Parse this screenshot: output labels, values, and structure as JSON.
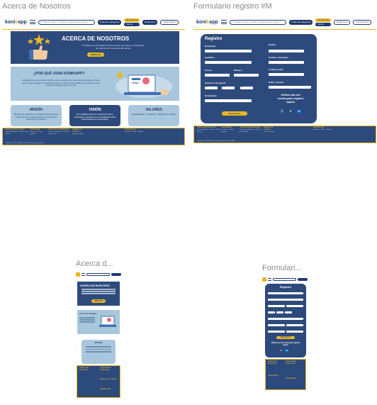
{
  "frames": {
    "acerca_desktop_label": "Acerca de Nosotros",
    "registro_desktop_label": "Formulario registro #M",
    "acerca_mobile_label": "Acerca d...",
    "registro_mobile_label": "Formulari..."
  },
  "header": {
    "logo_a": "koni",
    "logo_b": "k",
    "logo_c": "app",
    "search_placeholder": "Busca un libro, un título o búsqueda por género",
    "search_button": "Todas las categorías",
    "donate_label": "Donaciones",
    "cart_label": "Carrito",
    "register_label": "Registrarse",
    "login_label": "Iniciar Sesión"
  },
  "about": {
    "hero_title": "ACERCA DE NOSOTROS",
    "hero_text": "Konikapp es una plataforma de servicios que ofrece a estudiantes de pre/post las vivencias intercambio.",
    "hero_button": "EMPEZAR",
    "why_title": "¿POR QUÉ USAR KONIKAPP?",
    "why_text": "Konikapp ofrece el intercambio de libros entre los usuarios de la comunidad universitaria, de forma rápida, segura y gratuita, promoviendo la lectura y el ahorro de los estudiantes que buscan un libro o desean compartir los suyos con otros.",
    "cards": [
      {
        "title": "MISIÓN",
        "text": "Brindar a los estudiantes una plataforma de intercambio de libros que les permita acceder al conocimiento de manera fácil y económica."
      },
      {
        "title": "VISIÓN",
        "text": "Ser la plataforma líder en intercambio de libros universitarios, generando una comunidad de lectores comprometidos con el aprendizaje."
      },
      {
        "title": "VALORES",
        "text": "Responsabilidad · Honestidad · Colaboración · Respeto"
      }
    ]
  },
  "footer": {
    "col1_title": "ACERCA DE NOSOTROS",
    "col1_text": "Acerca de Nosotros · Misión · Visión · Valores",
    "col2_title": "CATEGORÍAS",
    "col2_text": "Literatura · Ciencias · Ingeniería",
    "col3_title": "POLÍTICAS DE PRIVACIDAD",
    "col3_text": "Términos y condiciones · Políticas de privacidad",
    "col4_title": "SERVICIO AL CLIENTE",
    "col4_text": "Contacto · Ayuda",
    "col5_title": "SÍGUENOS EN",
    "col5_text": "Facebook · Twitter · LinkedIn",
    "copyright": "Copyright © 2023 Konikapp. Todos los derechos reservados."
  },
  "registro": {
    "title": "Registro",
    "nombre": "Nombre(s)",
    "apellidos": "Apellidos",
    "correo": "Correo",
    "numero": "Número",
    "fecha": "Fecha de nacimiento",
    "dia": "Día",
    "mes": "Mes",
    "ano": "Año",
    "contrasena": "Contraseña",
    "estado": "Estado",
    "ciudad": "Ciudad o municipio",
    "cp": "Código postal",
    "calle": "Calle y número",
    "button": "Registrarse",
    "social": "Utiliza una red social para registro rápido"
  },
  "mobile_about": {
    "hero_title": "ACERCA DE NOSOTROS",
    "hero_button": "EMPEZAR",
    "why_title": "¿Por qué Konikapp?",
    "mision_title": "MISIÓN"
  },
  "mobile_registro": {
    "title": "Registro",
    "button": "Registrarse",
    "social": "Utiliza una red social para registro rápido"
  },
  "colors": {
    "navy": "#2d4a7c",
    "yellow": "#e9b824",
    "light_blue": "#a9c7dc"
  }
}
